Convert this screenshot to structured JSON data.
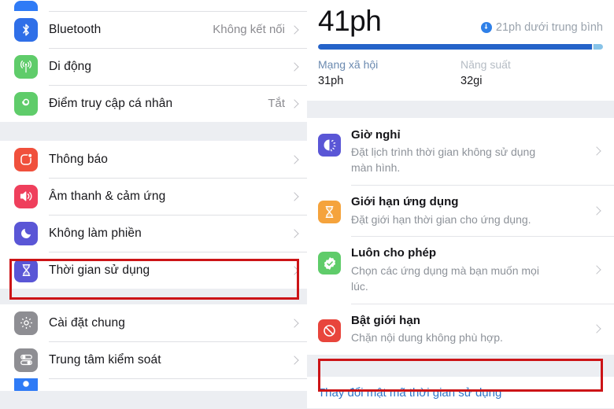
{
  "left_panel": {
    "groups": [
      {
        "name": "connectivity",
        "items": [
          {
            "label": "",
            "value": "",
            "icon": "wifi-icon",
            "color": "#2f7bf6",
            "clipped": "top"
          },
          {
            "label": "Bluetooth",
            "value": "Không kết nối",
            "icon": "bluetooth-icon",
            "color": "#2f6fe8"
          },
          {
            "label": "Di động",
            "value": "",
            "icon": "cellular-icon",
            "color": "#5fcc6a"
          },
          {
            "label": "Điểm truy cập cá nhân",
            "value": "Tắt",
            "icon": "hotspot-icon",
            "color": "#5fcc6a"
          }
        ]
      },
      {
        "name": "alerts",
        "items": [
          {
            "label": "Thông báo",
            "value": "",
            "icon": "notifications-icon",
            "color": "#f0503c"
          },
          {
            "label": "Âm thanh & cảm ứng",
            "value": "",
            "icon": "sounds-icon",
            "color": "#ef3f5c"
          },
          {
            "label": "Không làm phiền",
            "value": "",
            "icon": "moon-icon",
            "color": "#5a56d6"
          },
          {
            "label": "Thời gian sử dụng",
            "value": "",
            "icon": "hourglass-icon",
            "color": "#5a56d6",
            "highlighted": true
          }
        ]
      },
      {
        "name": "system",
        "items": [
          {
            "label": "Cài đặt chung",
            "value": "",
            "icon": "gear-icon",
            "color": "#8e8e93"
          },
          {
            "label": "Trung tâm kiểm soát",
            "value": "",
            "icon": "control-center-icon",
            "color": "#8e8e93"
          },
          {
            "label": "",
            "value": "",
            "icon": "display-icon",
            "color": "#2f7bf6",
            "clipped": "bottom"
          }
        ]
      }
    ]
  },
  "right_panel": {
    "summary": {
      "total": "41ph",
      "delta_text": "21ph dưới trung bình",
      "delta_icon": "arrow-down-circle-icon",
      "bar_main_percent": 96,
      "categories": [
        {
          "name": "Mạng xã hội",
          "value": "31ph"
        },
        {
          "name": "Năng suất",
          "value": "32gi"
        }
      ]
    },
    "options": [
      {
        "title": "Giờ nghỉ",
        "subtitle": "Đặt lịch trình thời gian không sử dụng màn hình.",
        "icon": "downtime-icon",
        "color": "#5a56d6"
      },
      {
        "title": "Giới hạn ứng dụng",
        "subtitle": "Đặt giới hạn thời gian cho ứng dụng.",
        "icon": "app-limits-icon",
        "color": "#f5a33c"
      },
      {
        "title": "Luôn cho phép",
        "subtitle": "Chọn các ứng dụng mà bạn muốn mọi lúc.",
        "icon": "always-allowed-icon",
        "color": "#5fcc6a"
      },
      {
        "title": "Bật giới hạn",
        "subtitle": "Chặn nội dung không phù hợp.",
        "icon": "restrictions-icon",
        "color": "#e8453c"
      }
    ],
    "passcode_link": "Thay đổi mật mã thời gian sử dụng"
  },
  "annotations": {
    "highlight_color": "#cc1417",
    "boxes": [
      {
        "name": "screen-time-row-highlight"
      },
      {
        "name": "passcode-link-highlight"
      }
    ]
  }
}
